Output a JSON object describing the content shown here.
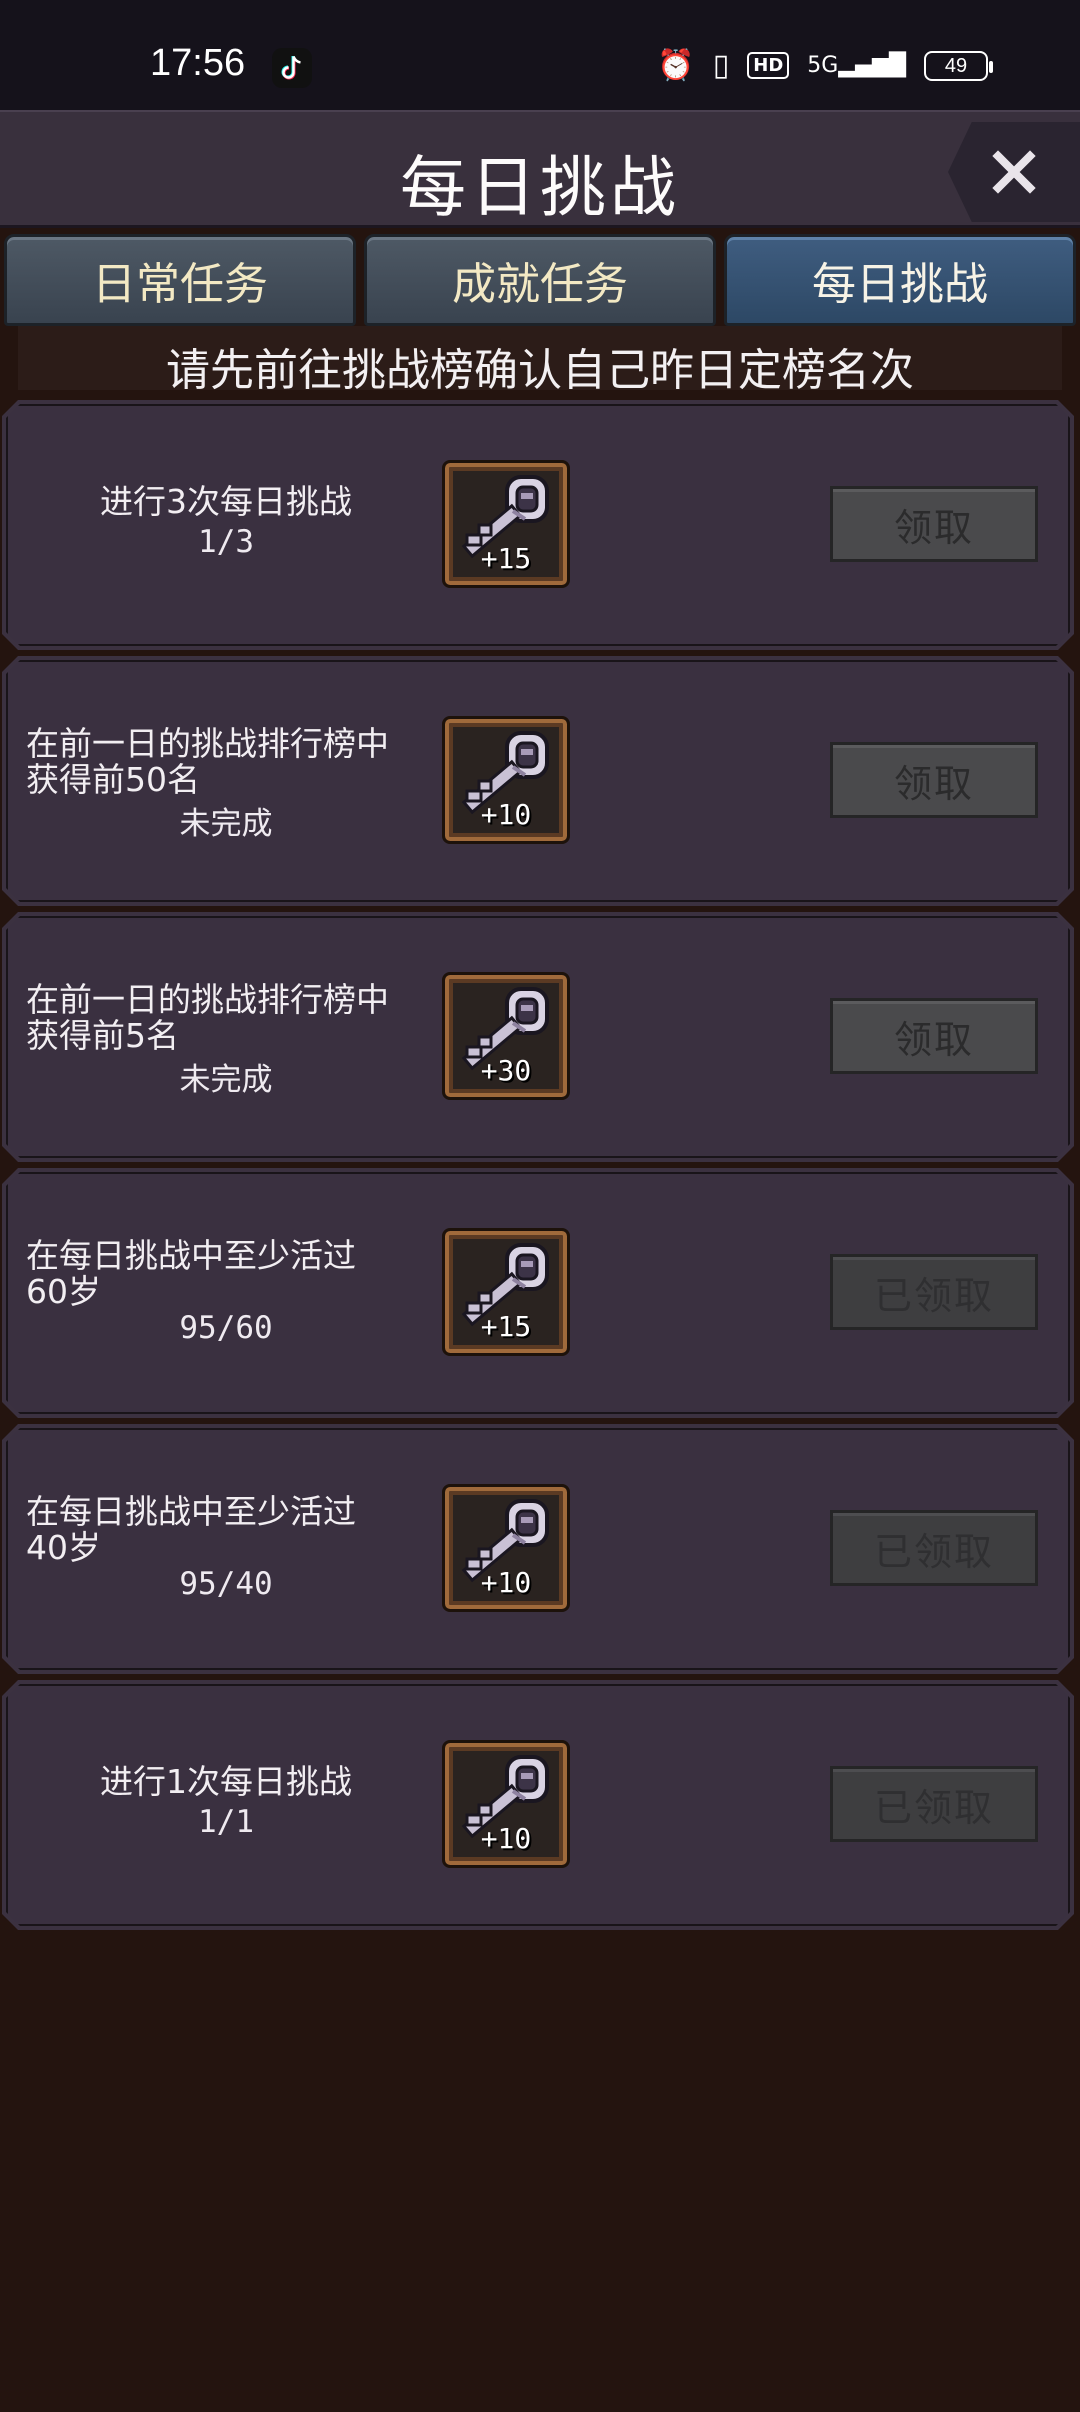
{
  "status_bar": {
    "time": "17:56",
    "network": "5G",
    "hd": "HD",
    "battery": "49"
  },
  "header": {
    "title": "每日挑战",
    "close_label": "×"
  },
  "tabs": [
    {
      "label": "日常任务",
      "active": false
    },
    {
      "label": "成就任务",
      "active": false
    },
    {
      "label": "每日挑战",
      "active": true
    }
  ],
  "notice": "请先前往挑战榜确认自己昨日定榜名次",
  "tasks": [
    {
      "line1": "进行3次每日挑战",
      "line2": "",
      "progress": "1/3",
      "reward_icon": "key-icon",
      "reward": "+15",
      "button": "领取",
      "claimed": false
    },
    {
      "line1": "在前一日的挑战排行榜中",
      "line2": "获得前50名",
      "progress": "未完成",
      "reward_icon": "key-icon",
      "reward": "+10",
      "button": "领取",
      "claimed": false
    },
    {
      "line1": "在前一日的挑战排行榜中",
      "line2": "获得前5名",
      "progress": "未完成",
      "reward_icon": "key-icon",
      "reward": "+30",
      "button": "领取",
      "claimed": false
    },
    {
      "line1": "在每日挑战中至少活过",
      "line2": "60岁",
      "progress": "95/60",
      "reward_icon": "key-icon",
      "reward": "+15",
      "button": "已领取",
      "claimed": true
    },
    {
      "line1": "在每日挑战中至少活过",
      "line2": "40岁",
      "progress": "95/40",
      "reward_icon": "key-icon",
      "reward": "+10",
      "button": "已领取",
      "claimed": true
    },
    {
      "line1": "进行1次每日挑战",
      "line2": "",
      "progress": "1/1",
      "reward_icon": "key-icon",
      "reward": "+10",
      "button": "已领取",
      "claimed": true
    }
  ]
}
